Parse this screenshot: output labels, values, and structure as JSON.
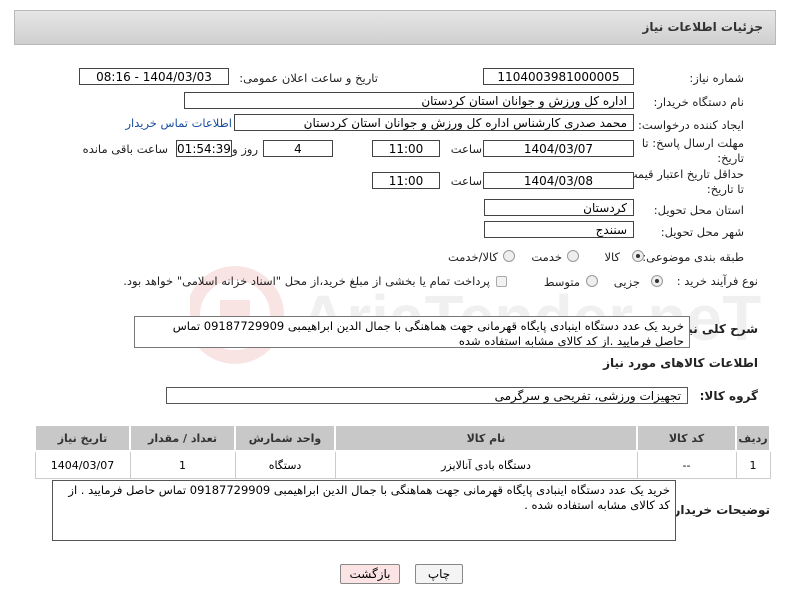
{
  "header": {
    "title": "جزئیات اطلاعات نیاز"
  },
  "fields": {
    "need_no_label": "شماره نیاز:",
    "need_no": "1104003981000005",
    "announce_label": "تاریخ و ساعت اعلان عمومی:",
    "announce_value": "1404/03/03 - 08:16",
    "buyer_label": "نام دستگاه خریدار:",
    "buyer": "اداره کل ورزش و جوانان استان کردستان",
    "creator_label": "ایجاد کننده درخواست:",
    "creator": "محمد صدری کارشناس اداره کل ورزش و جوانان استان کردستان",
    "contact_link": "اطلاعات تماس خریدار",
    "deadline_label_1": "مهلت ارسال پاسخ: تا",
    "deadline_label_2": "تاریخ:",
    "deadline_date": "1404/03/07",
    "time_label": "ساعت",
    "deadline_time": "11:00",
    "days_value": "4",
    "days_label": "روز و",
    "remaining_time": "01:54:39",
    "remaining_label": "ساعت باقی مانده",
    "price_label_1": "حداقل تاریخ اعتبار قیمت:",
    "price_label_2": "تا تاریخ:",
    "price_date": "1404/03/08",
    "price_time_label": "ساعت",
    "price_time": "11:00",
    "province_label": "استان محل تحویل:",
    "province": "کردستان",
    "city_label": "شهر محل تحویل:",
    "city": "سنندج",
    "category_label": "طبقه بندی موضوعی:",
    "cat_options": [
      "کالا",
      "خدمت",
      "کالا/خدمت"
    ],
    "purchase_label": "نوع فرآیند خرید :",
    "purchase_options": [
      "جزیی",
      "متوسط"
    ],
    "payment_note": "پرداخت تمام یا بخشی از مبلغ خرید،از محل \"اسناد خزانه اسلامی\" خواهد بود."
  },
  "summary": {
    "label": "شرح کلی نیاز:",
    "text": "خرید یک عدد دستگاه اینبادی پایگاه قهرمانی جهت هماهنگی با جمال الدین ابراهیمبی 09187729909 تماس حاصل فرمایید .از کد کالای مشابه استفاده شده"
  },
  "goods": {
    "section_title": "اطلاعات کالاهای مورد نیاز",
    "group_label": "گروه کالا:",
    "group_value": "تجهیزات ورزشی، تفریحی و سرگرمی",
    "columns": [
      "ردیف",
      "کد کالا",
      "نام کالا",
      "واحد شمارش",
      "تعداد / مقدار",
      "تاریخ نیاز"
    ],
    "rows": [
      [
        "1",
        "--",
        "دستگاه بادی آنالایزر",
        "دستگاه",
        "1",
        "1404/03/07"
      ]
    ]
  },
  "buyer_notes": {
    "label": "توضیحات خریدار:",
    "text": "خرید یک عدد دستگاه اینبادی  پایگاه قهرمانی جهت هماهنگی با جمال الدین ابراهیمبی 09187729909 تماس حاصل فرمایید . از کد کالای مشابه استفاده شده ."
  },
  "buttons": {
    "print": "چاپ",
    "back": "بازگشت"
  },
  "watermark": {
    "brand": "AriaTender.neT"
  },
  "colors": {
    "link": "#1a4fa0",
    "header_bg": "#d8d8d8",
    "back_button": "#fde4e4"
  }
}
